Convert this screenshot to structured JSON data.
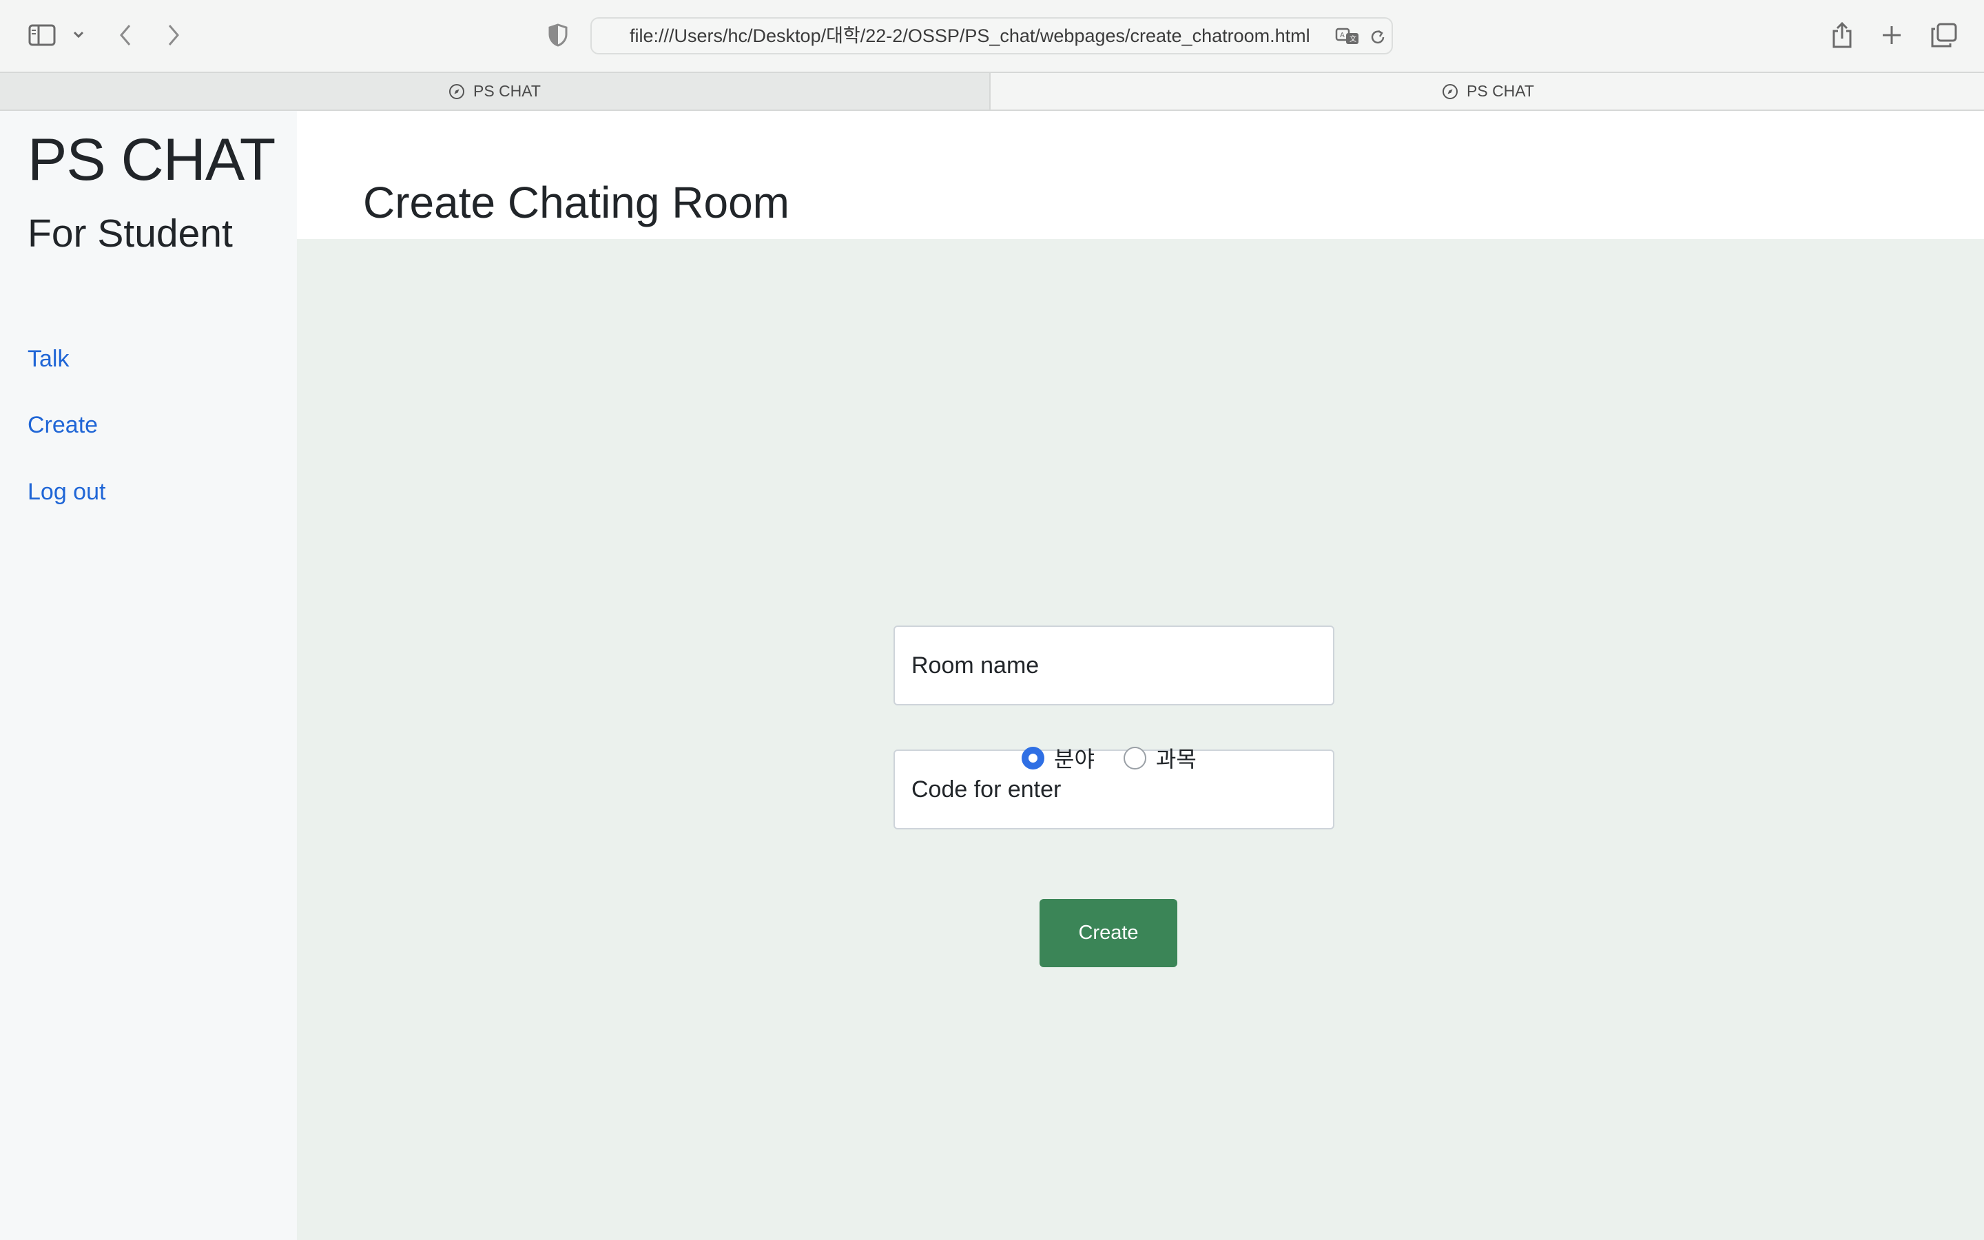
{
  "browser": {
    "address": "file:///Users/hc/Desktop/대학/22-2/OSSP/PS_chat/webpages/create_chatroom.html",
    "tabs": [
      {
        "label": "PS CHAT",
        "active": false
      },
      {
        "label": "PS CHAT",
        "active": true
      }
    ]
  },
  "sidebar": {
    "brand": "PS CHAT",
    "subtitle": "For Student",
    "nav": [
      {
        "label": "Talk"
      },
      {
        "label": "Create"
      },
      {
        "label": "Log out"
      }
    ]
  },
  "main": {
    "title": "Create Chating Room",
    "form": {
      "room_name_placeholder": "Room name",
      "room_name_value": "",
      "code_placeholder": "Code for enter",
      "code_value": "",
      "radio_options": [
        {
          "label": "분야",
          "checked": true
        },
        {
          "label": "과목",
          "checked": false
        }
      ],
      "submit_label": "Create"
    }
  },
  "colors": {
    "link": "#2066d6",
    "main_background": "#ebf1ed",
    "button": "#3b8557",
    "radio_checked": "#2f6fe4"
  }
}
